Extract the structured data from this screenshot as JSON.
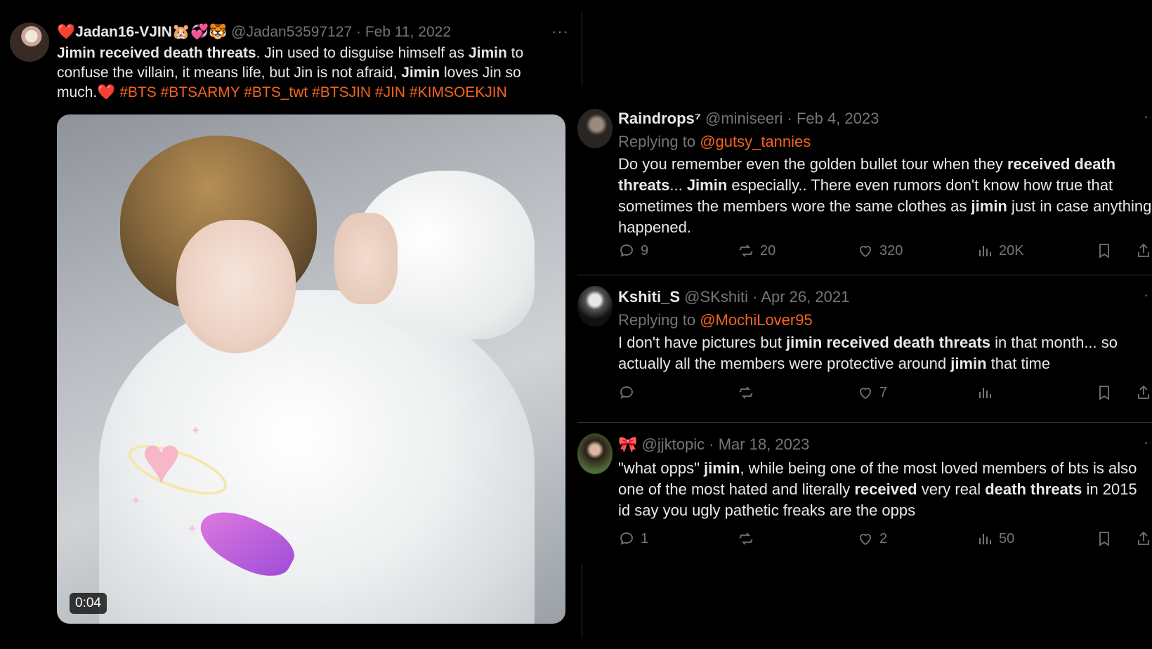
{
  "main_tweet": {
    "display_name": "❤️Jadan16-VJIN🐹💞🐯",
    "handle": "@Jadan53597127",
    "date": "Feb 11, 2022",
    "more": "···",
    "text_segments": [
      {
        "t": "Jimin received death threats",
        "b": true
      },
      {
        "t": ".  Jin used to disguise himself as ",
        "b": false
      },
      {
        "t": "Jimin",
        "b": true
      },
      {
        "t": " to confuse the villain, it means life, but Jin is not afraid, ",
        "b": false
      },
      {
        "t": "Jimin",
        "b": true
      },
      {
        "t": " loves Jin so much.",
        "b": false
      }
    ],
    "heart": "❤️",
    "hashtags": "#BTS #BTSARMY #BTS_twt #BTSJIN #JIN #KIMSOEKJIN",
    "video_timecode": "0:04"
  },
  "replies": [
    {
      "name": "Raindrops⁷",
      "handle": "@miniseeri",
      "date": "Feb 4, 2023",
      "replying_prefix": "Replying to ",
      "replying_to": "@gutsy_tannies",
      "segments": [
        {
          "t": "Do you remember even the golden bullet tour when they ",
          "b": false
        },
        {
          "t": "received death threats",
          "b": true
        },
        {
          "t": "... ",
          "b": false
        },
        {
          "t": "Jimin",
          "b": true
        },
        {
          "t": " especially.. There even rumors don't know how true that sometimes the members wore the same clothes as ",
          "b": false
        },
        {
          "t": "jimin",
          "b": true
        },
        {
          "t": " just in case anything happened.",
          "b": false
        }
      ],
      "stats": {
        "replies": "9",
        "reposts": "20",
        "likes": "320",
        "views": "20K"
      }
    },
    {
      "name": "Kshiti_S",
      "handle": "@SKshiti",
      "date": "Apr 26, 2021",
      "replying_prefix": "Replying to ",
      "replying_to": "@MochiLover95",
      "segments": [
        {
          "t": "I don't have pictures but ",
          "b": false
        },
        {
          "t": "jimin received death threats",
          "b": true
        },
        {
          "t": " in that month... so actually all the members were protective around ",
          "b": false
        },
        {
          "t": "jimin",
          "b": true
        },
        {
          "t": " that time",
          "b": false
        }
      ],
      "stats": {
        "replies": "",
        "reposts": "",
        "likes": "7",
        "views": ""
      }
    },
    {
      "name": "🎀",
      "handle": "@jjktopic",
      "date": "Mar 18, 2023",
      "replying_prefix": "",
      "replying_to": "",
      "segments": [
        {
          "t": "\"what opps\" ",
          "b": false
        },
        {
          "t": "jimin",
          "b": true
        },
        {
          "t": ", while being one of the most loved members of bts is also one of the most hated and literally ",
          "b": false
        },
        {
          "t": "received",
          "b": true
        },
        {
          "t": " very real ",
          "b": false
        },
        {
          "t": "death threats",
          "b": true
        },
        {
          "t": " in 2015 id say you ugly pathetic freaks are the opps",
          "b": false
        }
      ],
      "stats": {
        "replies": "1",
        "reposts": "",
        "likes": "2",
        "views": "50"
      }
    }
  ],
  "icons": [
    "reply-icon",
    "repost-icon",
    "like-icon",
    "views-icon",
    "bookmark-icon",
    "share-icon",
    "more-icon"
  ],
  "colors": {
    "background": "#000000",
    "text": "#e7e9ea",
    "muted": "#71767b",
    "accent": "#f4641f",
    "heart": "#e0245e"
  }
}
